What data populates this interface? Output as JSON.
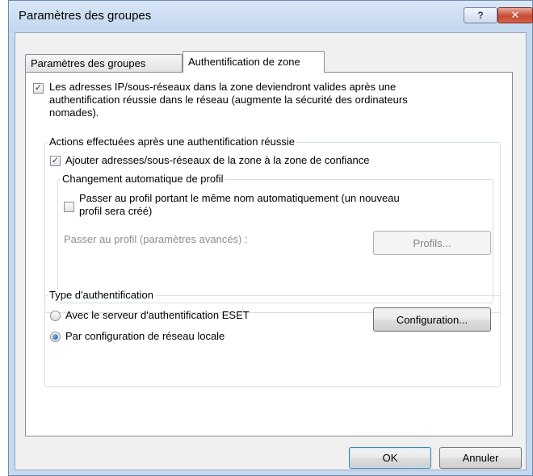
{
  "window": {
    "title": "Paramètres des groupes",
    "help_glyph": "?",
    "close_glyph": "✕"
  },
  "tabs": [
    {
      "label": "Paramètres des groupes",
      "active": false
    },
    {
      "label": "Authentification de zone",
      "active": true
    }
  ],
  "auth_zone": {
    "main_checkbox": {
      "checked": true,
      "lines": [
        "Les adresses IP/sous-réseaux dans la zone deviendront valides après une",
        "authentification réussie dans le réseau (augmente la sécurité des ordinateurs",
        "nomades)."
      ]
    },
    "actions_group": {
      "title": "Actions effectuées après une authentification réussie",
      "add_trusted": {
        "checked": true,
        "label": "Ajouter adresses/sous-réseaux de la zone à la zone de confiance"
      },
      "profile_group": {
        "title": "Changement automatique de profil",
        "switch_same_name": {
          "checked": false,
          "lines": [
            "Passer au profil portant le même nom automatiquement (un nouveau",
            "profil sera créé)"
          ]
        },
        "switch_advanced_label": "Passer au profil (paramètres avancés) :",
        "profiles_button": "Profils..."
      }
    },
    "auth_type_group": {
      "title": "Type d'authentification",
      "options": [
        {
          "label": "Avec le serveur d'authentification ESET",
          "selected": false
        },
        {
          "label": "Par configuration de réseau locale",
          "selected": true
        }
      ],
      "configuration_button": "Configuration..."
    }
  },
  "footer": {
    "ok_label": "OK",
    "cancel_label": "Annuler"
  },
  "colors": {
    "frame": "#c7d9ee",
    "accent": "#1a4fa3",
    "close": "#c64a32"
  }
}
